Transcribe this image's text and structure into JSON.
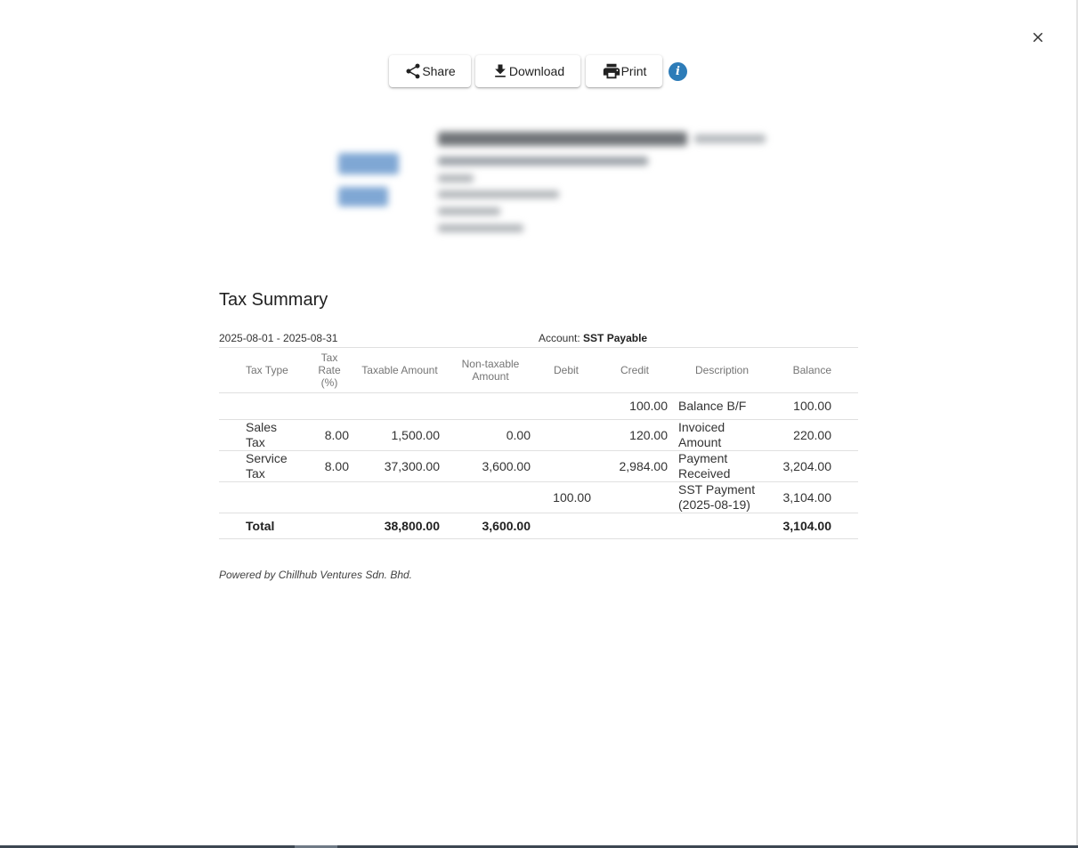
{
  "toolbar": {
    "share_label": "Share",
    "download_label": "Download",
    "print_label": "Print",
    "info_glyph": "i"
  },
  "icons": {
    "close": "close-icon",
    "share": "share-icon",
    "download": "download-icon",
    "print": "print-icon",
    "info": "info-icon"
  },
  "colors": {
    "info_accent": "#2d7cb8",
    "text": "#212121",
    "header_text": "#757575"
  },
  "report": {
    "title": "Tax Summary",
    "period": "2025-08-01 - 2025-08-31",
    "account_label": "Account:",
    "account_value": "SST Payable",
    "columns": {
      "tax_type": "Tax Type",
      "tax_rate": "Tax Rate (%)",
      "taxable": "Taxable Amount",
      "nontaxable": "Non-taxable Amount",
      "debit": "Debit",
      "credit": "Credit",
      "description": "Description",
      "balance": "Balance"
    },
    "rows": [
      {
        "tax_type": "",
        "tax_rate": "",
        "taxable": "",
        "nontaxable": "",
        "debit": "",
        "credit": "100.00",
        "description": "Balance B/F",
        "balance": "100.00"
      },
      {
        "tax_type": "Sales Tax",
        "tax_rate": "8.00",
        "taxable": "1,500.00",
        "nontaxable": "0.00",
        "debit": "",
        "credit": "120.00",
        "description": "Invoiced Amount",
        "balance": "220.00"
      },
      {
        "tax_type": "Service Tax",
        "tax_rate": "8.00",
        "taxable": "37,300.00",
        "nontaxable": "3,600.00",
        "debit": "",
        "credit": "2,984.00",
        "description": "Payment Received",
        "balance": "3,204.00"
      },
      {
        "tax_type": "",
        "tax_rate": "",
        "taxable": "",
        "nontaxable": "",
        "debit": "100.00",
        "credit": "",
        "description": "SST Payment (2025-08-19)",
        "balance": "3,104.00"
      }
    ],
    "total": {
      "label": "Total",
      "taxable": "38,800.00",
      "nontaxable": "3,600.00",
      "balance": "3,104.00"
    },
    "powered_by": "Powered by Chillhub Ventures Sdn. Bhd."
  }
}
